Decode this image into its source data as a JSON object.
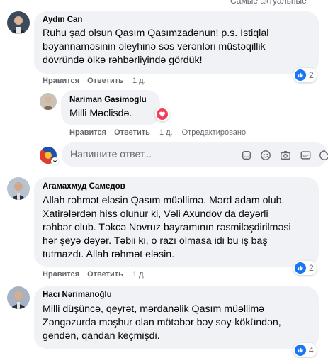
{
  "top_cut_text": "Самые актуальные",
  "comments": [
    {
      "author": "Aydın Can",
      "lines": [
        "Ruhu şad olsun Qasım Qasımzadənun! p.s. İstiqlal",
        "bəyannaməsinin əleyhinə səs verənləri müstəqillik",
        "dövründə ölkə rəhbərliyində gördük!"
      ],
      "like_label": "Нравится",
      "reply_label": "Ответить",
      "time": "1 д.",
      "reactions": "2"
    },
    {
      "author": "Nariman Gasimoglu",
      "lines": [
        "Milli Məclisdə."
      ],
      "like_label": "Нравится",
      "reply_label": "Ответить",
      "time": "1 д.",
      "edited": "Отредактировано",
      "reactions": ""
    },
    {
      "author": "Агамахмуд Самедов",
      "lines": [
        "Allah rəhmət eləsin Qasım müəllimə. Mərd adam olub.",
        "Xatirələrdən hiss olunur ki, Vəli Axundov da dəyərli",
        "rəhbər olub. Təkcə Novruz bayramının rəsmiləşdirilməsi",
        "hər şeyə dəyər. Təbii ki, o razı olmasa idi bu iş baş",
        "tutmazdı. Allah rəhmət eləsin."
      ],
      "like_label": "Нравится",
      "reply_label": "Ответить",
      "time": "1 д.",
      "reactions": "2"
    },
    {
      "author": "Hacı Nərimanoğlu",
      "lines": [
        "Milli düşüncə, qeyrət, mərdanəlik Qasım müəllimə",
        "Zəngəzurda məşhur olan mötəbər bəy soy-kökündən,",
        "gendən, qandan keçmişdi."
      ],
      "reactions": "4"
    }
  ],
  "reply_input": {
    "placeholder": "Напишите ответ..."
  },
  "icons": {
    "reactions_like": "like-icon",
    "reactions_love": "heart-icon",
    "reply_tools": [
      "sticker-icon",
      "emoji-icon",
      "camera-icon",
      "gif-icon",
      "sticker-face-icon"
    ]
  },
  "colors": {
    "like_blue": "#1877f2",
    "love_red": "#f33e58",
    "bubble_bg": "#f0f2f5",
    "meta_gray": "#65676b"
  }
}
